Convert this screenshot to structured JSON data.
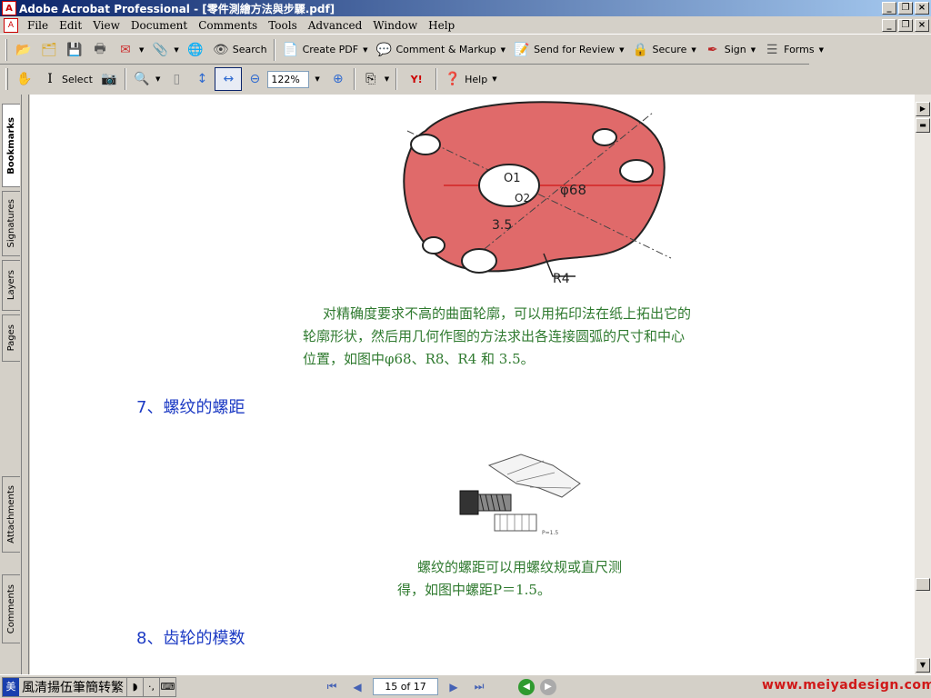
{
  "window": {
    "title": "Adobe Acrobat Professional - [零件測繪方法與步驟.pdf]"
  },
  "menu": [
    "File",
    "Edit",
    "View",
    "Document",
    "Comments",
    "Tools",
    "Advanced",
    "Window",
    "Help"
  ],
  "toolbar1": {
    "search_label": "Search",
    "create_pdf_label": "Create PDF",
    "comment_label": "Comment & Markup",
    "review_label": "Send for Review",
    "secure_label": "Secure",
    "sign_label": "Sign",
    "forms_label": "Forms"
  },
  "toolbar2": {
    "select_label": "Select",
    "zoom_value": "122%",
    "help_label": "Help"
  },
  "nav_tabs": [
    "Bookmarks",
    "Signatures",
    "Layers",
    "Pages",
    "Attachments",
    "Comments"
  ],
  "document": {
    "figure1_labels": {
      "o1": "O1",
      "o2": "O2",
      "phi68": "φ68",
      "r4": "R4",
      "v35": "3.5"
    },
    "para1_lines": [
      "对精确度要求不高的曲面轮廓，可以用拓印法在纸上拓出它的",
      "轮廓形状，然后用几何作图的方法求出各连接圆弧的尺寸和中心",
      "位置，如图中φ68、R8、R4 和 3.5。"
    ],
    "heading7": "7、螺纹的螺距",
    "figure2_label": "P=1.5",
    "para2_lines": [
      "螺纹的螺距可以用螺纹规或直尺测",
      "得，如图中螺距P＝1.5。"
    ],
    "heading8": "8、齿轮的模数"
  },
  "status": {
    "ime_icon": "美",
    "ime_text": "風清揚伍筆簡转繁",
    "page_display": "15 of 17",
    "watermark": "www.meiyadesign.com"
  },
  "colors": {
    "title_gradient_start": "#0a246a",
    "body_text_green": "#2f7a2f",
    "heading_blue": "#1d3bc4",
    "figure_red": "#e06a6a",
    "watermark_red": "#d01818"
  }
}
